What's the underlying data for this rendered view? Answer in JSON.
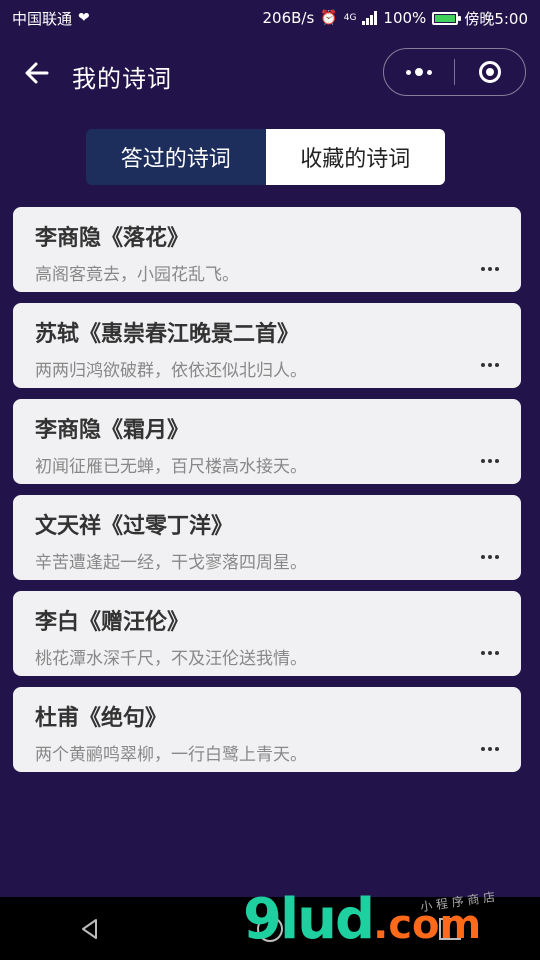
{
  "status_bar": {
    "carrier": "中国联通",
    "speed": "206B/s",
    "network": "4G",
    "battery": "100%",
    "time": "傍晚5:00",
    "battery_color": "#3fd15a"
  },
  "nav": {
    "title": "我的诗词",
    "back_icon": "arrow-left-icon",
    "more_icon": "dots-icon",
    "close_icon": "target-icon"
  },
  "tabs": [
    {
      "label": "答过的诗词",
      "active": true
    },
    {
      "label": "收藏的诗词",
      "active": false
    }
  ],
  "poems": [
    {
      "title": "李商隐《落花》",
      "line": "高阁客竟去，小园花乱飞。"
    },
    {
      "title": "苏轼《惠崇春江晚景二首》",
      "line": "两两归鸿欲破群，依依还似北归人。"
    },
    {
      "title": "李商隐《霜月》",
      "line": "初闻征雁已无蝉，百尺楼高水接天。"
    },
    {
      "title": "文天祥《过零丁洋》",
      "line": "辛苦遭逢起一经，干戈寥落四周星。"
    },
    {
      "title": "李白《赠汪伦》",
      "line": "桃花潭水深千尺，不及汪伦送我情。"
    },
    {
      "title": "杜甫《绝句》",
      "line": "两个黄鹂鸣翠柳，一行白鹭上青天。"
    }
  ],
  "watermark": {
    "main": "9lud",
    "suffix": ".com",
    "sub": "小 程 序 商 店"
  },
  "colors": {
    "background": "#22144a",
    "tab_active": "#1e2e5c",
    "card": "#f1f1f3"
  }
}
